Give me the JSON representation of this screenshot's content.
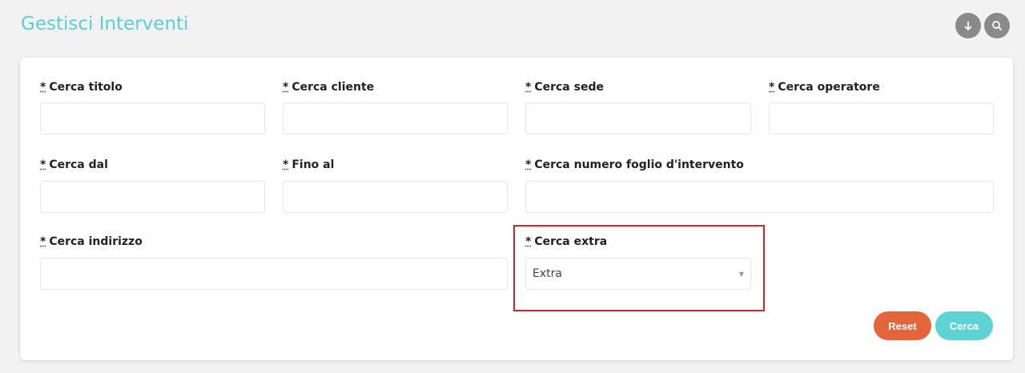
{
  "header": {
    "title": "Gestisci Interventi",
    "download_icon": "arrow-down-icon",
    "search_icon": "search-icon"
  },
  "form": {
    "required_mark": "*",
    "fields": [
      {
        "label": "Cerca titolo",
        "value": ""
      },
      {
        "label": "Cerca cliente",
        "value": ""
      },
      {
        "label": "Cerca sede",
        "value": ""
      },
      {
        "label": "Cerca operatore",
        "value": ""
      },
      {
        "label": "Cerca dal",
        "value": ""
      },
      {
        "label": "Fino al",
        "value": ""
      },
      {
        "label": "Cerca numero foglio d'intervento",
        "value": ""
      },
      {
        "label": "Cerca indirizzo",
        "value": ""
      },
      {
        "label": "Cerca extra",
        "value": "Extra"
      }
    ],
    "reset_label": "Reset",
    "search_label": "Cerca"
  },
  "colors": {
    "accent": "#5ccfcf",
    "reset": "#e4653b",
    "highlight": "#d9232a"
  }
}
